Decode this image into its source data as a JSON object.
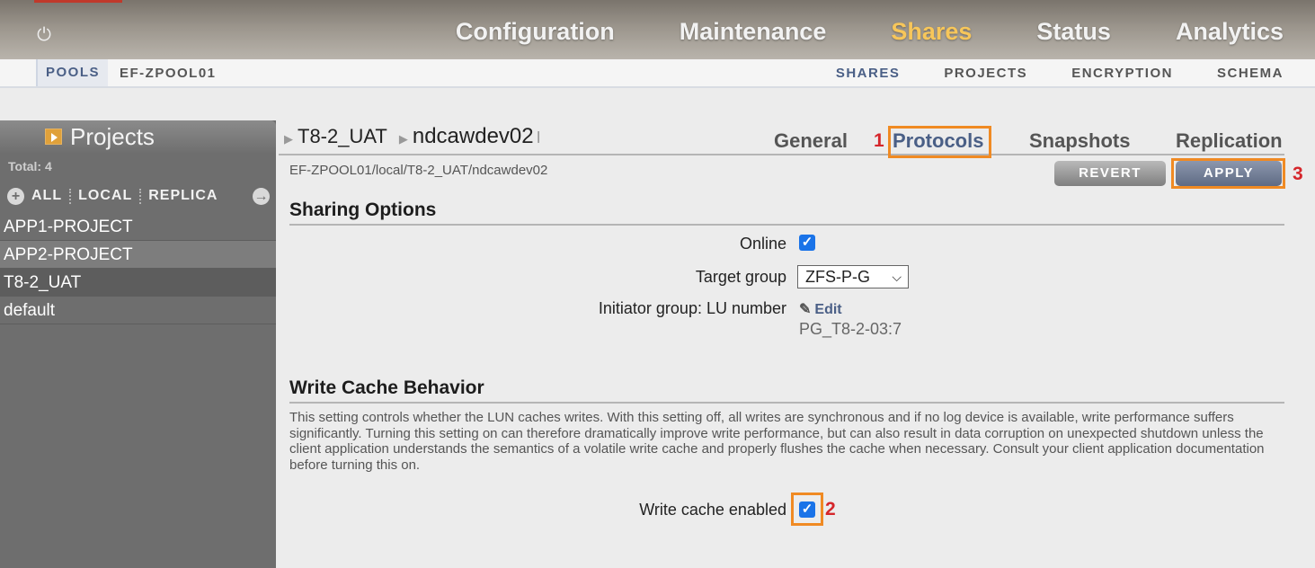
{
  "header": {
    "nav": [
      "Configuration",
      "Maintenance",
      "Shares",
      "Status",
      "Analytics"
    ],
    "active_nav": "Shares",
    "power_icon": "power-icon"
  },
  "subnav": {
    "pools_label": "POOLS",
    "pool_name": "EF-ZPOOL01",
    "tabs": [
      "SHARES",
      "PROJECTS",
      "ENCRYPTION",
      "SCHEMA"
    ]
  },
  "sidebar": {
    "title": "Projects",
    "total": "Total: 4",
    "filters": [
      "ALL",
      "LOCAL",
      "REPLICA"
    ],
    "items": [
      "APP1-PROJECT",
      "APP2-PROJECT",
      "T8-2_UAT",
      "default"
    ]
  },
  "main": {
    "breadcrumb_project": "T8-2_UAT",
    "breadcrumb_share": "ndcawdev02",
    "tabs": [
      "General",
      "Protocols",
      "Snapshots",
      "Replication"
    ],
    "path": "EF-ZPOOL01/local/T8-2_UAT/ndcawdev02",
    "revert_label": "REVERT",
    "apply_label": "APPLY",
    "sharing": {
      "title": "Sharing Options",
      "online_label": "Online",
      "target_group_label": "Target group",
      "target_group_value": "ZFS-P-G",
      "initiator_label": "Initiator group: LU number",
      "edit_label": "Edit",
      "initiator_value": "PG_T8-2-03:7"
    },
    "write_cache": {
      "title": "Write Cache Behavior",
      "description": "This setting controls whether the LUN caches writes. With this setting off, all writes are synchronous and if no log device is available, write performance suffers significantly. Turning this setting on can therefore dramatically improve write performance, but can also result in data corruption on unexpected shutdown unless the client application understands the semantics of a volatile write cache and properly flushes the cache when necessary. Consult your client application documentation before turning this on.",
      "enabled_label": "Write cache enabled"
    }
  },
  "annotations": {
    "mark1": "1",
    "mark2": "2",
    "mark3": "3",
    "highlight_color": "#f08a23",
    "mark_color": "#d5262b"
  }
}
